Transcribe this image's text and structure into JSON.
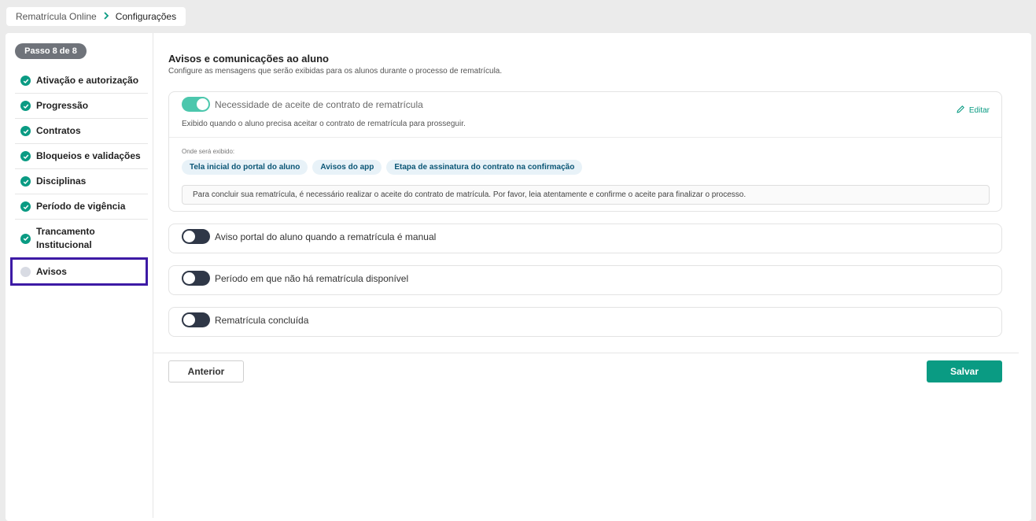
{
  "breadcrumb": {
    "items": [
      "Rematrícula Online",
      "Configurações"
    ],
    "separator_icon": "chevron-right-icon"
  },
  "sidebar": {
    "step_badge": "Passo 8 de 8",
    "steps": [
      {
        "label": "Ativação e autorização",
        "status": "done"
      },
      {
        "label": "Progressão",
        "status": "done"
      },
      {
        "label": "Contratos",
        "status": "done"
      },
      {
        "label": "Bloqueios e validações",
        "status": "done"
      },
      {
        "label": "Disciplinas",
        "status": "done"
      },
      {
        "label": "Período de vigência",
        "status": "done"
      },
      {
        "label": "Trancamento Institucional",
        "status": "done"
      },
      {
        "label": "Avisos",
        "status": "current"
      }
    ]
  },
  "main": {
    "title": "Avisos e comunicações ao aluno",
    "subtitle": "Configure as mensagens que serão exibidas para os alunos durante o processo de rematrícula.",
    "notices": [
      {
        "label": "Necessidade de aceite de contrato de rematrícula",
        "enabled": true,
        "edit_label": "Editar",
        "description": "Exibido quando o aluno precisa aceitar o contrato de rematrícula para prosseguir.",
        "where_label": "Onde será exibido:",
        "locations": [
          "Tela inicial do portal do aluno",
          "Avisos do app",
          "Etapa de assinatura do contrato na confirmação"
        ],
        "message": "Para concluir sua rematrícula, é necessário realizar o aceite do contrato de matrícula. Por favor, leia atentamente e confirme o aceite para finalizar o processo."
      },
      {
        "label": "Aviso portal do aluno quando a rematrícula é manual",
        "enabled": false
      },
      {
        "label": "Período em que não há rematrícula disponível",
        "enabled": false
      },
      {
        "label": "Rematrícula concluída",
        "enabled": false
      }
    ]
  },
  "footer": {
    "prev_label": "Anterior",
    "save_label": "Salvar"
  },
  "colors": {
    "accent": "#0a9b83",
    "toggle_on": "#4cc7ad",
    "toggle_off": "#2f3747",
    "active_outline": "#3d1aa5"
  }
}
